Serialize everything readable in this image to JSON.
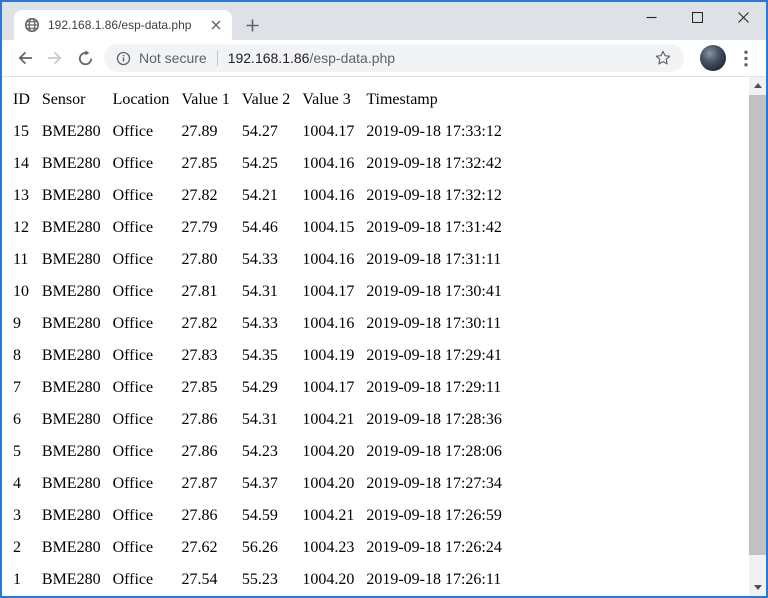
{
  "colors": {
    "window_border": "#2878d7",
    "tabstrip_bg": "#dee1e6",
    "toolbar_bg": "#ffffff",
    "omnibox_bg": "#f1f3f4",
    "icon_gray": "#5f6368",
    "text_dark": "#202124",
    "scroll_track": "#f1f1f1",
    "scroll_thumb": "#c1c1c1"
  },
  "browser": {
    "tab_title": "192.168.1.86/esp-data.php",
    "security_label": "Not secure",
    "url_host": "192.168.1.86",
    "url_path": "/esp-data.php"
  },
  "page": {
    "table": {
      "headers": [
        "ID",
        "Sensor",
        "Location",
        "Value 1",
        "Value 2",
        "Value 3",
        "Timestamp"
      ],
      "rows": [
        [
          "15",
          "BME280",
          "Office",
          "27.89",
          "54.27",
          "1004.17",
          "2019-09-18 17:33:12"
        ],
        [
          "14",
          "BME280",
          "Office",
          "27.85",
          "54.25",
          "1004.16",
          "2019-09-18 17:32:42"
        ],
        [
          "13",
          "BME280",
          "Office",
          "27.82",
          "54.21",
          "1004.16",
          "2019-09-18 17:32:12"
        ],
        [
          "12",
          "BME280",
          "Office",
          "27.79",
          "54.46",
          "1004.15",
          "2019-09-18 17:31:42"
        ],
        [
          "11",
          "BME280",
          "Office",
          "27.80",
          "54.33",
          "1004.16",
          "2019-09-18 17:31:11"
        ],
        [
          "10",
          "BME280",
          "Office",
          "27.81",
          "54.31",
          "1004.17",
          "2019-09-18 17:30:41"
        ],
        [
          "9",
          "BME280",
          "Office",
          "27.82",
          "54.33",
          "1004.16",
          "2019-09-18 17:30:11"
        ],
        [
          "8",
          "BME280",
          "Office",
          "27.83",
          "54.35",
          "1004.19",
          "2019-09-18 17:29:41"
        ],
        [
          "7",
          "BME280",
          "Office",
          "27.85",
          "54.29",
          "1004.17",
          "2019-09-18 17:29:11"
        ],
        [
          "6",
          "BME280",
          "Office",
          "27.86",
          "54.31",
          "1004.21",
          "2019-09-18 17:28:36"
        ],
        [
          "5",
          "BME280",
          "Office",
          "27.86",
          "54.23",
          "1004.20",
          "2019-09-18 17:28:06"
        ],
        [
          "4",
          "BME280",
          "Office",
          "27.87",
          "54.37",
          "1004.20",
          "2019-09-18 17:27:34"
        ],
        [
          "3",
          "BME280",
          "Office",
          "27.86",
          "54.59",
          "1004.21",
          "2019-09-18 17:26:59"
        ],
        [
          "2",
          "BME280",
          "Office",
          "27.62",
          "56.26",
          "1004.23",
          "2019-09-18 17:26:24"
        ],
        [
          "1",
          "BME280",
          "Office",
          "27.54",
          "55.23",
          "1004.20",
          "2019-09-18 17:26:11"
        ]
      ]
    }
  }
}
